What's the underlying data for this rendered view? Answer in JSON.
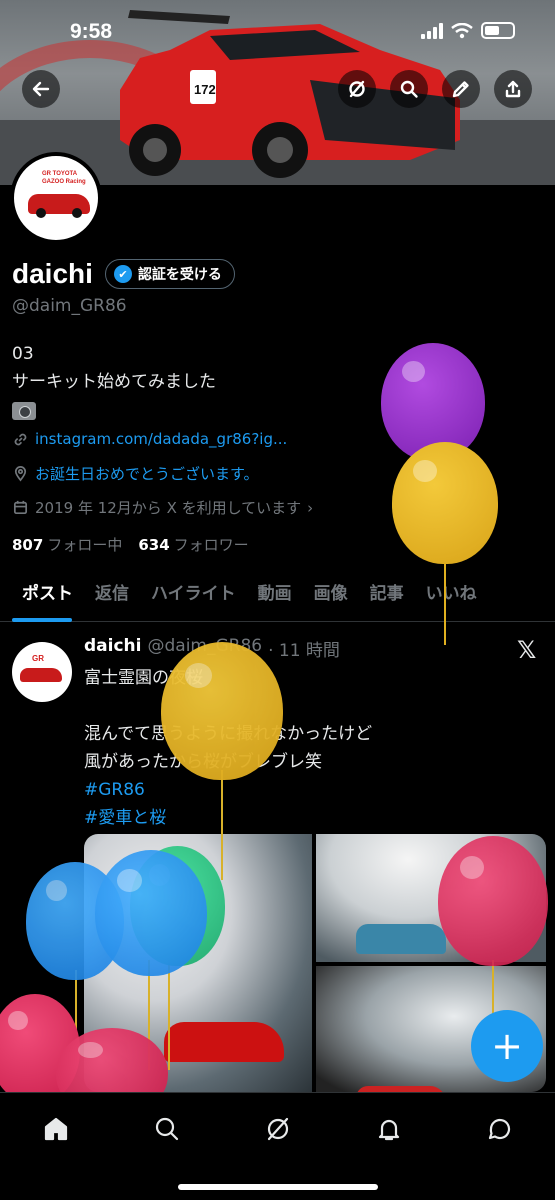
{
  "status_bar": {
    "time": "9:58"
  },
  "header": {
    "back_icon": "back-arrow-icon",
    "grok_icon": "grok-icon",
    "search_icon": "search-icon",
    "edit_icon": "pencil-icon",
    "share_icon": "share-icon"
  },
  "profile": {
    "display_name": "daichi",
    "verify_label": "認証を受ける",
    "handle": "@daim_GR86",
    "avatar_logo": "GR TOYOTA GAZOO Racing",
    "bio_lines": [
      "03",
      "サーキット始めてみました"
    ],
    "link": "instagram.com/dadada_gr86?ig...",
    "birthday": "お誕生日おめでとうございます。",
    "joined": "2019 年 12月から X を利用しています",
    "following_count": "807",
    "following_label": "フォロー中",
    "followers_count": "634",
    "followers_label": "フォロワー"
  },
  "tabs": [
    "ポスト",
    "返信",
    "ハイライト",
    "動画",
    "画像",
    "記事",
    "いいね"
  ],
  "post": {
    "name": "daichi",
    "handle": "@daim_GR86",
    "time": "· 11 時間",
    "lines": [
      "富士霊園の夜桜",
      "",
      "混んでて思うように撮れなかったけど",
      "風があったから桜がブレブレ笑"
    ],
    "hashtags": [
      "#GR86",
      "#愛車と桜"
    ],
    "x_logo": "𝕏"
  },
  "fab_label": "+",
  "bottom_nav": [
    "home-icon",
    "search-icon",
    "grok-icon",
    "notifications-icon",
    "messages-icon"
  ],
  "colors": {
    "accent": "#1d9bf0",
    "background": "#000000",
    "muted": "#71767b"
  }
}
